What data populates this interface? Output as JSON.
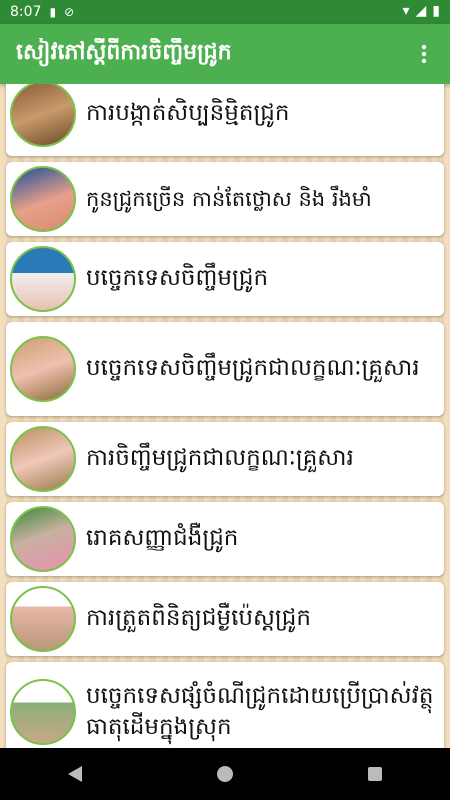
{
  "status_bar": {
    "time": "8:07"
  },
  "app_bar": {
    "title": "សៀវភៅស្តីពីការចិញ្ចឹមជ្រូក"
  },
  "items": [
    {
      "label": "ការបង្កាត់សិប្បនិម្មិតជ្រូក"
    },
    {
      "label": "កូនជ្រូកច្រើន កាន់តែថ្លោស និង រឹងមាំ"
    },
    {
      "label": "បច្ចេកទេសចិញ្ចឹមជ្រូក"
    },
    {
      "label": "បច្ចេកទេសចិញ្ចឹមជ្រូកជាលក្ខណៈគ្រួសារ"
    },
    {
      "label": "ការចិញ្ចឹមជ្រូកជាលក្ខណៈគ្រួសារ"
    },
    {
      "label": "រោគសញ្ញាជំងឺជ្រូក"
    },
    {
      "label": "ការត្រួតពិនិត្យជម្ងឺប៉េស្តជ្រូក"
    },
    {
      "label": "បច្ចេកទេសផ្សំចំណីជ្រូកដោយប្រើប្រាស់វត្ថុធាតុដើមក្នុងស្រុក"
    }
  ],
  "colors": {
    "status_bar": "#2e8a34",
    "app_bar": "#4caf50",
    "thumb_border": "#7cc24a"
  }
}
